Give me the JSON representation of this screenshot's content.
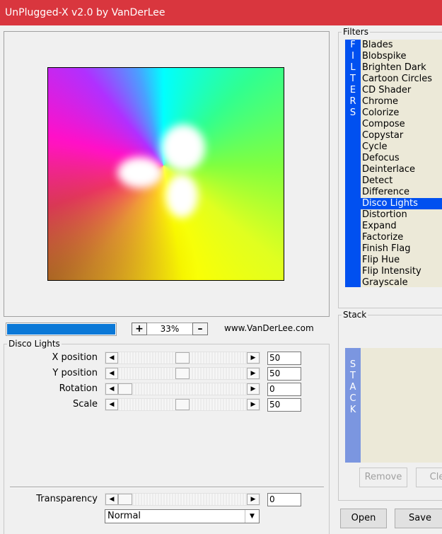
{
  "window": {
    "title": "UnPlugged-X v2.0 by VanDerLee"
  },
  "preview": {
    "progress_percent": 100,
    "zoom_label": "33%",
    "zoom_in_label": "+",
    "zoom_out_label": "–",
    "website": "www.VanDerLee.com"
  },
  "filter_group": {
    "title": "Disco Lights",
    "params": [
      {
        "label": "X position",
        "value": "50",
        "fraction": 0.5
      },
      {
        "label": "Y position",
        "value": "50",
        "fraction": 0.5
      },
      {
        "label": "Rotation",
        "value": "0",
        "fraction": 0.0
      },
      {
        "label": "Scale",
        "value": "50",
        "fraction": 0.5
      }
    ],
    "transparency": {
      "label": "Transparency",
      "value": "0",
      "fraction": 0.0
    },
    "blend_mode": "Normal"
  },
  "filters": {
    "title": "Filters",
    "tab_label": "FILTERS",
    "selected": "Disco Lights",
    "items": [
      "Blades",
      "Blobspike",
      "Brighten Dark",
      "Cartoon Circles",
      "CD Shader",
      "Chrome",
      "Colorize",
      "Compose",
      "Copystar",
      "Cycle",
      "Defocus",
      "Deinterlace",
      "Detect",
      "Difference",
      "Disco Lights",
      "Distortion",
      "Expand",
      "Factorize",
      "Finish Flag",
      "Flip Hue",
      "Flip Intensity",
      "Grayscale"
    ]
  },
  "stack": {
    "title": "Stack",
    "tab_label": "STACK",
    "remove_label": "Remove",
    "clear_label": "Cle"
  },
  "buttons": {
    "open_label": "Open",
    "save_label": "Save"
  },
  "colors": {
    "title_bar": "#d9363e",
    "selection": "#0050f0",
    "list_bg": "#ece9d8",
    "progress": "#0a78d7"
  }
}
